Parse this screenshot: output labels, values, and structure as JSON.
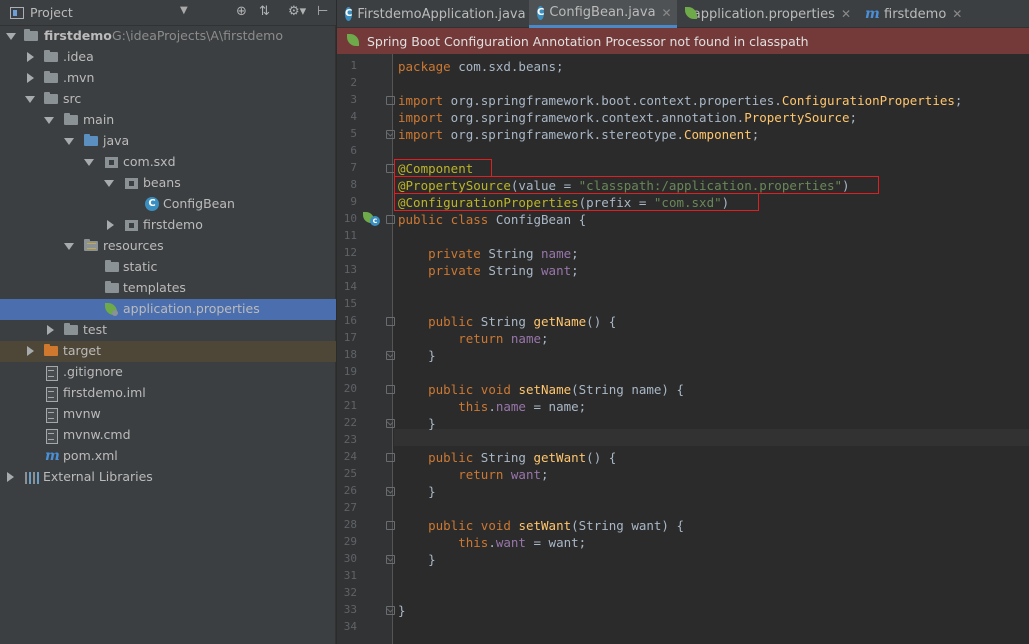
{
  "project": {
    "title": "Project",
    "tree": [
      {
        "label": "firstdemo",
        "hint": "G:\\ideaProjects\\A\\firstdemo"
      },
      {
        "label": ".idea"
      },
      {
        "label": ".mvn"
      },
      {
        "label": "src"
      },
      {
        "label": "main"
      },
      {
        "label": "java"
      },
      {
        "label": "com.sxd"
      },
      {
        "label": "beans"
      },
      {
        "label": "ConfigBean"
      },
      {
        "label": "firstdemo"
      },
      {
        "label": "resources"
      },
      {
        "label": "static"
      },
      {
        "label": "templates"
      },
      {
        "label": "application.properties"
      },
      {
        "label": "test"
      },
      {
        "label": "target"
      },
      {
        "label": ".gitignore"
      },
      {
        "label": "firstdemo.iml"
      },
      {
        "label": "mvnw"
      },
      {
        "label": "mvnw.cmd"
      },
      {
        "label": "pom.xml"
      },
      {
        "label": "External Libraries"
      }
    ]
  },
  "tabs": [
    {
      "label": "FirstdemoApplication.java"
    },
    {
      "label": "ConfigBean.java"
    },
    {
      "label": "application.properties"
    },
    {
      "label": "firstdemo"
    }
  ],
  "warning": "Spring Boot Configuration Annotation Processor not found in classpath",
  "line_numbers": [
    "1",
    "2",
    "3",
    "4",
    "5",
    "6",
    "7",
    "8",
    "9",
    "10",
    "11",
    "12",
    "13",
    "14",
    "15",
    "16",
    "17",
    "18",
    "19",
    "20",
    "21",
    "22",
    "23",
    "24",
    "25",
    "26",
    "27",
    "28",
    "29",
    "30",
    "31",
    "32",
    "33",
    "34"
  ],
  "code": {
    "l1": [
      "package",
      " com.sxd.beans;"
    ],
    "l3": [
      "import",
      " org.springframework.boot.context.properties.",
      "ConfigurationProperties",
      ";"
    ],
    "l4": [
      "import",
      " org.springframework.context.annotation.",
      "PropertySource",
      ";"
    ],
    "l5": [
      "import",
      " org.springframework.stereotype.",
      "Component",
      ";"
    ],
    "l7": [
      "@Component"
    ],
    "l8": [
      "@PropertySource",
      "(value = ",
      "\"classpath:/application.properties\"",
      ")"
    ],
    "l9": [
      "@ConfigurationProperties",
      "(prefix = ",
      "\"com.sxd\"",
      ")"
    ],
    "l10": [
      "public class",
      " ConfigBean {"
    ],
    "l12": [
      "    ",
      "private",
      " String ",
      "name",
      ";"
    ],
    "l13": [
      "    ",
      "private",
      " String ",
      "want",
      ";"
    ],
    "l16": [
      "    ",
      "public",
      " String ",
      "getName",
      "() {"
    ],
    "l17": [
      "        ",
      "return",
      " ",
      "name",
      ";"
    ],
    "l18": [
      "    }"
    ],
    "l20": [
      "    ",
      "public void",
      " ",
      "setName",
      "(String name) {"
    ],
    "l21": [
      "        ",
      "this",
      ".",
      "name",
      " = name;"
    ],
    "l22": [
      "    }"
    ],
    "l24": [
      "    ",
      "public",
      " String ",
      "getWant",
      "() {"
    ],
    "l25": [
      "        ",
      "return",
      " ",
      "want",
      ";"
    ],
    "l26": [
      "    }"
    ],
    "l28": [
      "    ",
      "public void",
      " ",
      "setWant",
      "(String want) {"
    ],
    "l29": [
      "        ",
      "this",
      ".",
      "want",
      " = want;"
    ],
    "l30": [
      "    }"
    ],
    "l33": [
      "}"
    ]
  },
  "colors": {
    "keyword": "#cc7832",
    "annotation": "#bbb529",
    "string": "#6a8759",
    "field": "#9876aa",
    "method": "#ffc66d",
    "selection": "#4b6eaf",
    "highlight_box": "#e02020"
  }
}
